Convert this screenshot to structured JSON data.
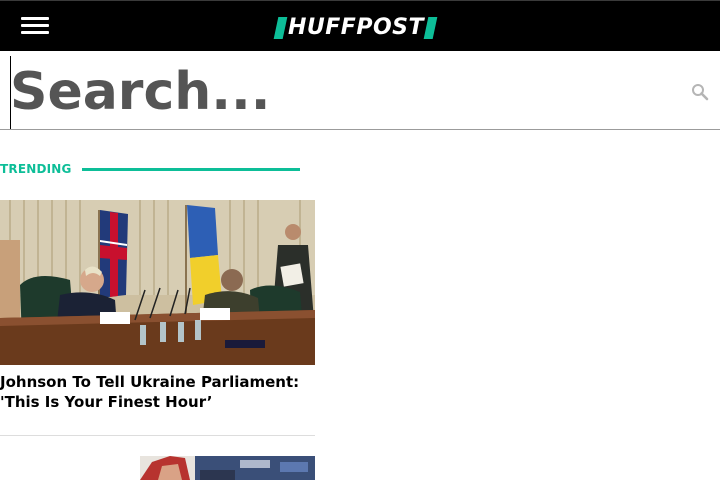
{
  "header": {
    "menu_icon": "hamburger-menu-icon",
    "logo_text": "HUFFPOST",
    "brand_color": "#0dbe98",
    "background": "#000000"
  },
  "search": {
    "placeholder": "Search...",
    "value": "",
    "icon": "magnifier-icon"
  },
  "trending": {
    "label": "TRENDING",
    "accent_color": "#0dbe98"
  },
  "articles": [
    {
      "title": "Johnson To Tell Ukraine Parliament: 'This Is Your Finest Hour’",
      "image": "photo-leaders-meeting-flags"
    },
    {
      "title": "",
      "image": "photo-partial"
    }
  ]
}
